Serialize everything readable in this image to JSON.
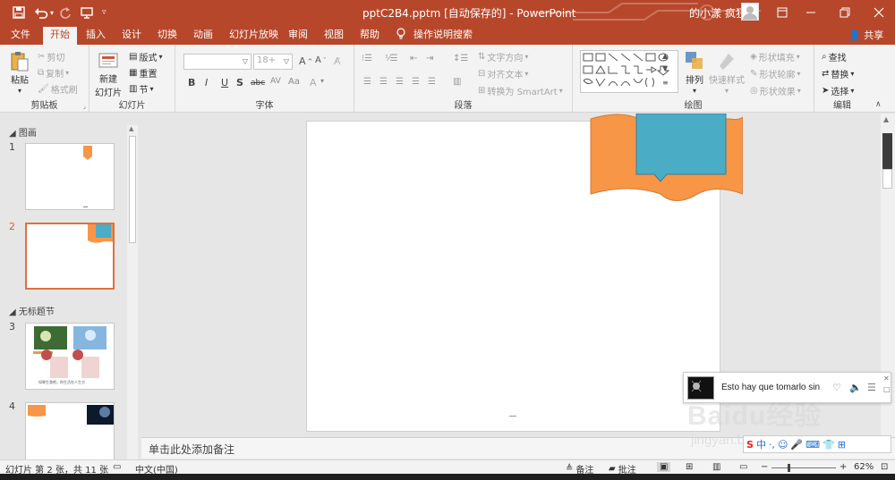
{
  "titlebar": {
    "doc_title": "pptC2B4.pptm [自动保存的]  -  PowerPoint",
    "user_name": "的小漾 疯狂",
    "icons": [
      "save-icon",
      "undo-icon",
      "redo-icon",
      "present-icon",
      "customize-qat-icon"
    ],
    "window_buttons": [
      "ribbon-display-icon",
      "minimize-icon",
      "restore-icon",
      "close-icon"
    ]
  },
  "menu": {
    "tabs": [
      "文件",
      "开始",
      "插入",
      "设计",
      "切换",
      "动画",
      "幻灯片放映",
      "审阅",
      "视图",
      "帮助"
    ],
    "active": "开始",
    "tell_me": "操作说明搜索",
    "share": "共享"
  },
  "ribbon": {
    "clipboard": {
      "paste": "粘贴",
      "cut": "剪切",
      "copy": "复制",
      "format_painter": "格式刷",
      "label": "剪贴板"
    },
    "slides": {
      "new_slide": "新建",
      "new_slide_2": "幻灯片",
      "layout": "版式",
      "reset": "重置",
      "section": "节",
      "label": "幻灯片"
    },
    "font": {
      "font_size": "18+",
      "bold": "B",
      "italic": "I",
      "underline": "U",
      "shadow": "S",
      "strike": "abc",
      "label": "字体"
    },
    "paragraph": {
      "text_direction": "文字方向",
      "align_text": "对齐文本",
      "smartart": "转换为 SmartArt",
      "label": "段落"
    },
    "drawing": {
      "arrange": "排列",
      "quick_styles": "快速样式",
      "shape_fill": "形状填充",
      "shape_outline": "形状轮廓",
      "shape_effects": "形状效果",
      "label": "绘图"
    },
    "editing": {
      "find": "查找",
      "replace": "替换",
      "select": "选择",
      "label": "编辑"
    }
  },
  "slides_pane": {
    "sections": [
      "图画",
      "无标题节"
    ],
    "slide_numbers": [
      "1",
      "2",
      "3",
      "4"
    ],
    "thumb3_caption": "如果生我吧，你生活在人生方"
  },
  "notes": {
    "placeholder": "单击此处添加备注"
  },
  "status": {
    "slide_info": "幻灯片 第 2 张，共 11 张",
    "language": "中文(中国)",
    "notes": "备注",
    "comments": "批注",
    "zoom": "62%"
  },
  "music_popup": {
    "text": "Esto hay que tomarlo sin"
  },
  "watermark": {
    "brand": "Baidu经验",
    "url": "jingyan.baidu.com"
  },
  "colors": {
    "accent": "#b7472a",
    "banner_orange": "#f79646",
    "banner_teal": "#4bacc6"
  }
}
